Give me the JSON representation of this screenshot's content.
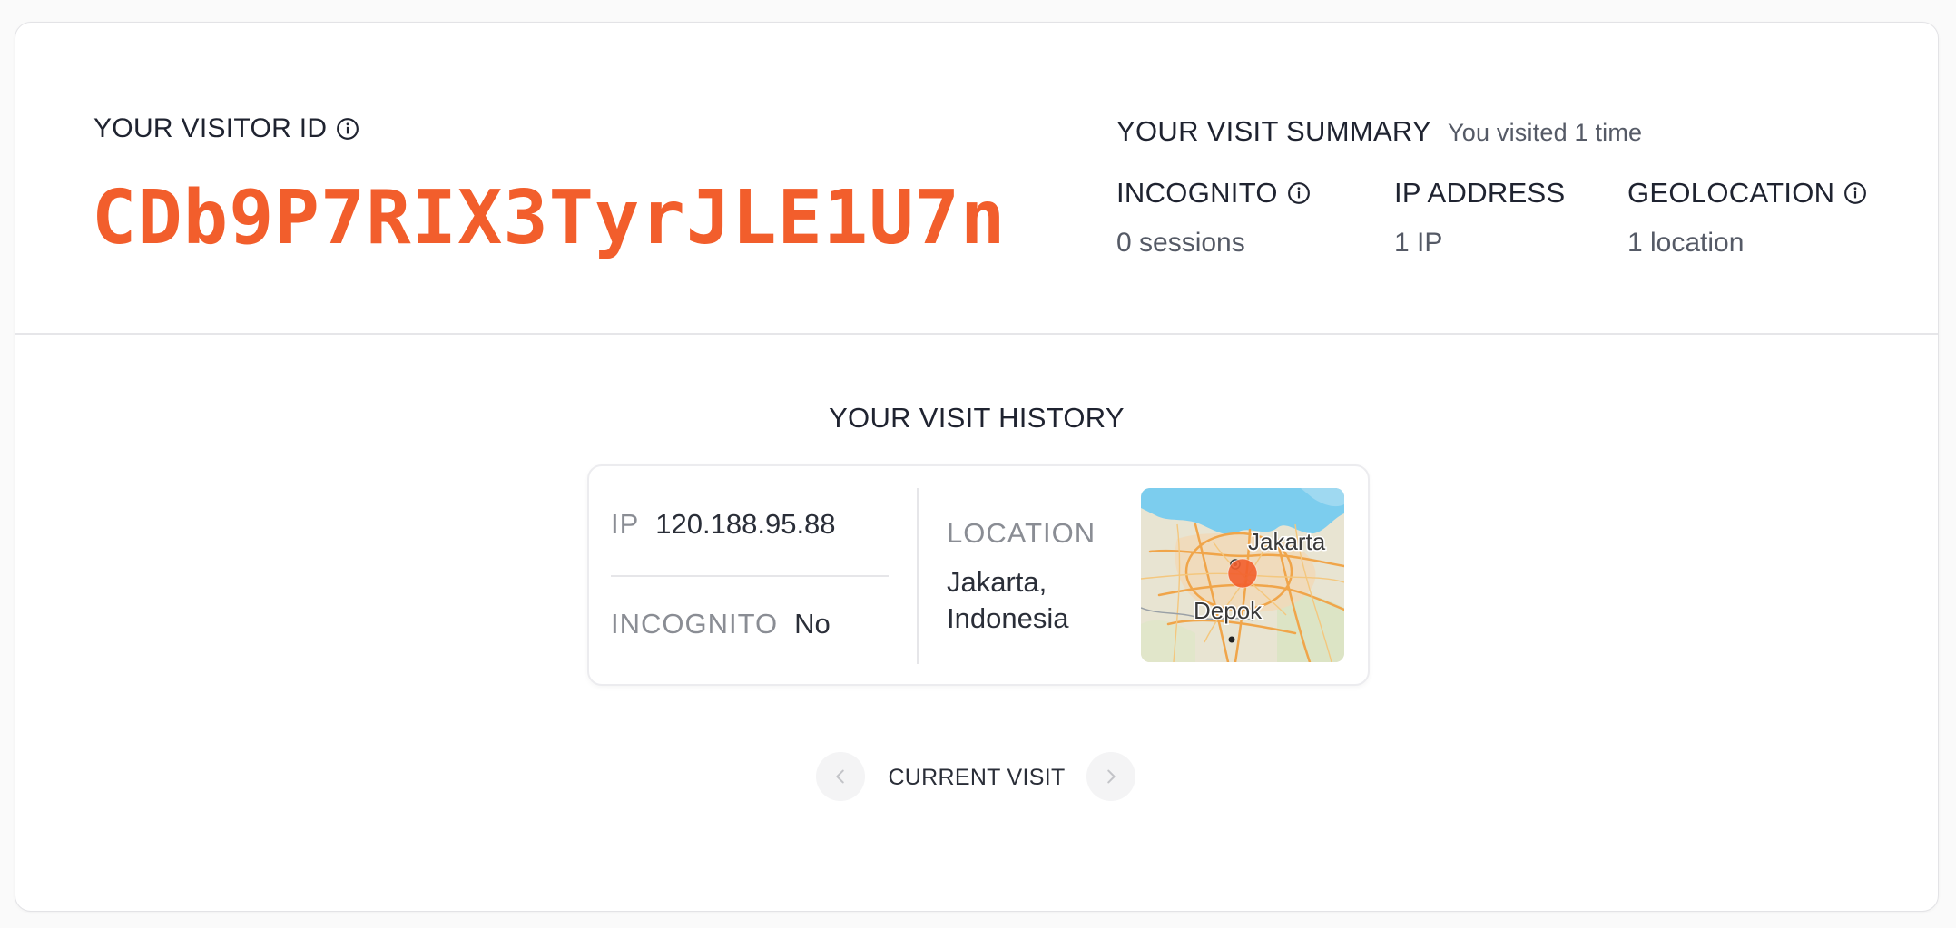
{
  "visitor": {
    "label": "YOUR VISITOR ID",
    "id": "CDb9P7RIX3TyrJLE1U7n",
    "accent_color": "#f25e2c"
  },
  "summary": {
    "title": "YOUR VISIT SUMMARY",
    "subtitle": "You visited 1 time",
    "stats": [
      {
        "label": "INCOGNITO",
        "value": "0 sessions",
        "icon": "info-icon"
      },
      {
        "label": "IP ADDRESS",
        "value": "1 IP"
      },
      {
        "label": "GEOLOCATION",
        "value": "1 location",
        "icon": "info-icon"
      }
    ]
  },
  "history": {
    "title": "YOUR VISIT HISTORY",
    "visit": {
      "ip_label": "IP",
      "ip_value": "120.188.95.88",
      "incognito_label": "INCOGNITO",
      "incognito_value": "No",
      "location_label": "LOCATION",
      "location_value": "Jakarta, Indonesia",
      "map_labels": [
        "Jakarta",
        "Depok"
      ]
    },
    "nav": {
      "label": "CURRENT VISIT",
      "prev_icon": "chevron-left-icon",
      "next_icon": "chevron-right-icon"
    }
  }
}
